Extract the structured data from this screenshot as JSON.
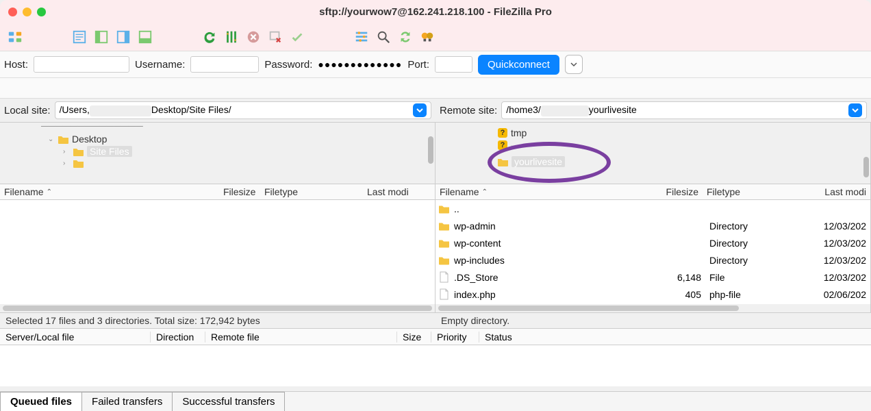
{
  "window": {
    "title": "sftp://yourwow7@162.241.218.100 - FileZilla Pro"
  },
  "connect": {
    "host_label": "Host:",
    "username_label": "Username:",
    "password_label": "Password:",
    "password_value": "●●●●●●●●●●●●●",
    "port_label": "Port:",
    "quickconnect": "Quickconnect"
  },
  "sites": {
    "local_label": "Local site:",
    "local_prefix": "/Users,",
    "local_suffix": "Desktop/Site Files/",
    "remote_label": "Remote site:",
    "remote_prefix": "/home3/",
    "remote_suffix": "yourlivesite"
  },
  "local_tree": {
    "desktop": "Desktop",
    "site_files": "Site Files"
  },
  "remote_tree": {
    "tmp": "tmp",
    "yourlivesite": "yourlivesite"
  },
  "columns": {
    "filename": "Filename",
    "filesize": "Filesize",
    "filetype": "Filetype",
    "last_modified": "Last modi"
  },
  "remote_files": [
    {
      "name": "..",
      "size": "",
      "type": "",
      "date": "",
      "icon": "folder"
    },
    {
      "name": "wp-admin",
      "size": "",
      "type": "Directory",
      "date": "12/03/202",
      "icon": "folder"
    },
    {
      "name": "wp-content",
      "size": "",
      "type": "Directory",
      "date": "12/03/202",
      "icon": "folder"
    },
    {
      "name": "wp-includes",
      "size": "",
      "type": "Directory",
      "date": "12/03/202",
      "icon": "folder"
    },
    {
      "name": ".DS_Store",
      "size": "6,148",
      "type": "File",
      "date": "12/03/202",
      "icon": "file"
    },
    {
      "name": "index.php",
      "size": "405",
      "type": "php-file",
      "date": "02/06/202",
      "icon": "file"
    }
  ],
  "status": {
    "local": "Selected 17 files and 3 directories. Total size: 172,942 bytes",
    "remote": "Empty directory."
  },
  "queue_cols": {
    "server": "Server/Local file",
    "direction": "Direction",
    "remote": "Remote file",
    "size": "Size",
    "priority": "Priority",
    "status": "Status"
  },
  "tabs": {
    "queued": "Queued files",
    "failed": "Failed transfers",
    "successful": "Successful transfers"
  }
}
